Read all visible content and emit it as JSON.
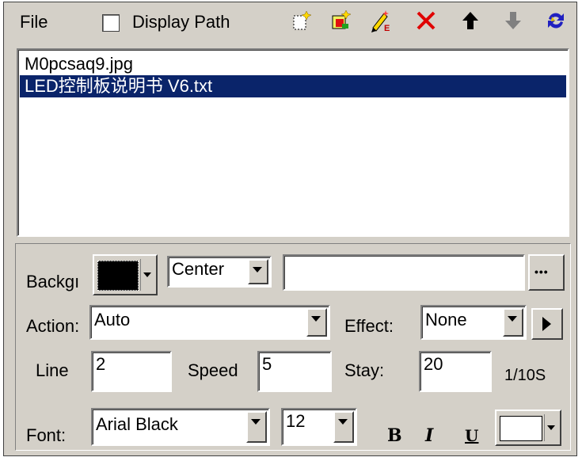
{
  "toolbar": {
    "file_label": "File",
    "display_path_label": "Display Path",
    "display_path_checked": false,
    "icons": [
      "new-file-icon",
      "open-file-icon",
      "edit-text-icon",
      "delete-icon",
      "move-up-icon",
      "move-down-icon",
      "refresh-icon"
    ]
  },
  "file_list": {
    "items": [
      "M0pcsaq9.jpg",
      "LED控制板说明书 V6.txt"
    ],
    "selected_index": 1
  },
  "settings": {
    "background_label": "Backgı",
    "background_color": "#000000",
    "align_value": "Center",
    "path_value": "",
    "browse_label": "•••",
    "action_label": "Action:",
    "action_value": "Auto",
    "effect_label": "Effect:",
    "effect_value": "None",
    "line_label": "Line",
    "line_value": "2",
    "speed_label": "Speed",
    "speed_value": "5",
    "stay_label": "Stay:",
    "stay_value": "20",
    "stay_unit": "1/10S",
    "font_label": "Font:",
    "font_value": "Arial Black",
    "size_value": "12",
    "bold_label": "B",
    "italic_label": "I",
    "underline_label": "U",
    "text_color": "#ffffff"
  },
  "colors": {
    "selection": "#0a246a",
    "panel": "#d4d0c8"
  }
}
